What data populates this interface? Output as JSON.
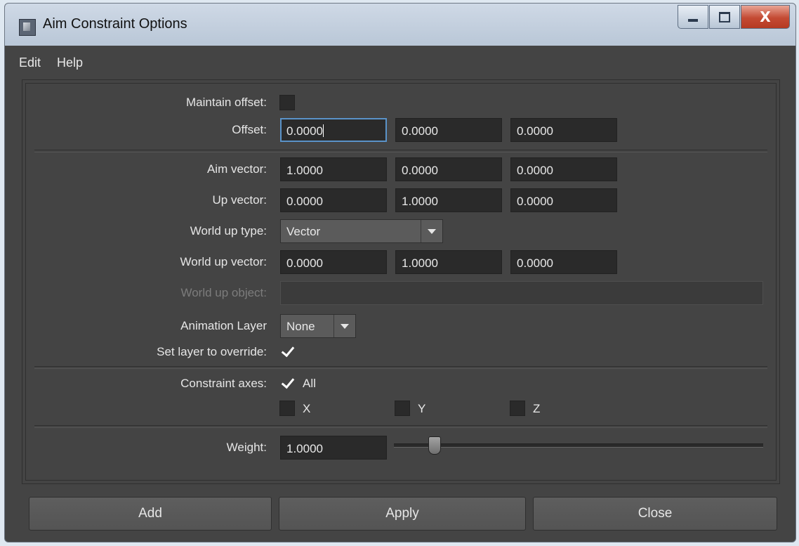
{
  "window": {
    "title": "Aim Constraint Options",
    "close_glyph": "X"
  },
  "menu": [
    "Edit",
    "Help"
  ],
  "form": {
    "maintain_offset_label": "Maintain offset:",
    "maintain_offset": false,
    "offset_label": "Offset:",
    "offset": [
      "0.0000",
      "0.0000",
      "0.0000"
    ],
    "aim_vector_label": "Aim vector:",
    "aim_vector": [
      "1.0000",
      "0.0000",
      "0.0000"
    ],
    "up_vector_label": "Up vector:",
    "up_vector": [
      "0.0000",
      "1.0000",
      "0.0000"
    ],
    "world_up_type_label": "World up type:",
    "world_up_type": "Vector",
    "world_up_vector_label": "World up vector:",
    "world_up_vector": [
      "0.0000",
      "1.0000",
      "0.0000"
    ],
    "world_up_object_label": "World up object:",
    "world_up_object": "",
    "animation_layer_label": "Animation Layer",
    "animation_layer": "None",
    "set_layer_override_label": "Set layer to override:",
    "set_layer_override": true,
    "constraint_axes_label": "Constraint axes:",
    "axes": {
      "all_label": "All",
      "all": true,
      "x_label": "X",
      "x": false,
      "y_label": "Y",
      "y": false,
      "z_label": "Z",
      "z": false
    },
    "weight_label": "Weight:",
    "weight": "1.0000",
    "weight_slider_fraction": 0.11
  },
  "buttons": {
    "add": "Add",
    "apply": "Apply",
    "close": "Close"
  },
  "icons": {
    "app": "maya-app-icon",
    "minimize": "minimize-icon",
    "maximize": "maximize-icon",
    "close": "close-icon"
  }
}
